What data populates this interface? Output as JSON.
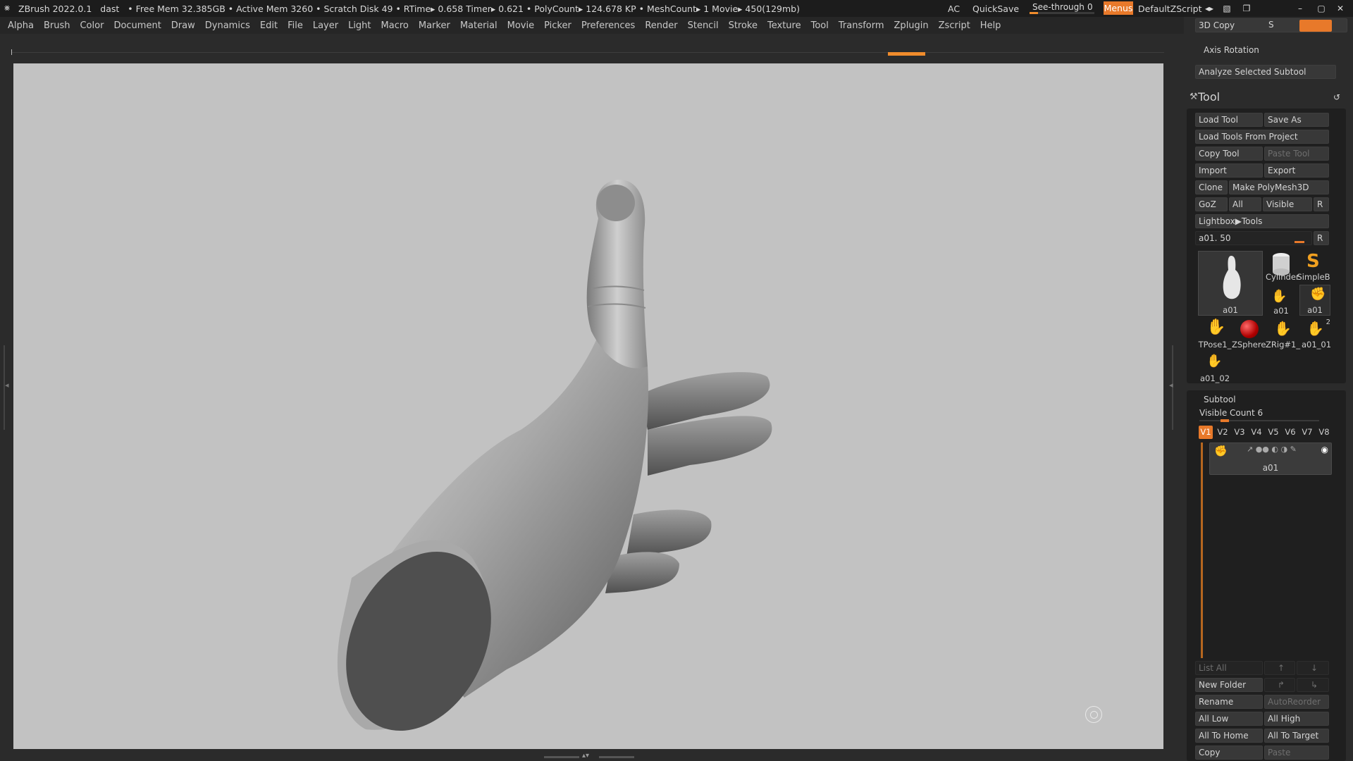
{
  "titlebar": {
    "app": "ZBrush 2022.0.1",
    "project": "dast",
    "stats": "• Free Mem 32.385GB • Active Mem 3260 • Scratch Disk 49 • RTime▸ 0.658 Timer▸ 0.621 • PolyCount▸ 124.678 KP • MeshCount▸ 1  Movie▸ 450(129mb)",
    "ac": "AC",
    "quicksave": "QuickSave",
    "seethrough_label": "See-through",
    "seethrough_value": "0",
    "menus": "Menus",
    "script": "DefaultZScript"
  },
  "menubar": [
    "Alpha",
    "Brush",
    "Color",
    "Document",
    "Draw",
    "Dynamics",
    "Edit",
    "File",
    "Layer",
    "Light",
    "Macro",
    "Marker",
    "Material",
    "Movie",
    "Picker",
    "Preferences",
    "Render",
    "Stencil",
    "Stroke",
    "Texture",
    "Tool",
    "Transform",
    "Zplugin",
    "Zscript",
    "Help"
  ],
  "top_panel": {
    "copy3d": "3D Copy",
    "s": "S",
    "axis_rotation": "Axis Rotation",
    "analyze": "Analyze Selected Subtool"
  },
  "tool": {
    "title": "Tool",
    "load_tool": "Load Tool",
    "save_as": "Save As",
    "load_from_project": "Load Tools From Project",
    "copy_tool": "Copy Tool",
    "paste_tool": "Paste Tool",
    "import": "Import",
    "export": "Export",
    "clone": "Clone",
    "make_polymesh": "Make PolyMesh3D",
    "goz": "GoZ",
    "all": "All",
    "visible": "Visible",
    "r": "R",
    "lightbox": "Lightbox▶Tools",
    "current_label": "a01. 50",
    "thumbs": [
      {
        "name": "a01"
      },
      {
        "name": "Cylinder"
      },
      {
        "name": "SimpleB"
      },
      {
        "name": "a01"
      },
      {
        "name": "a01"
      },
      {
        "name": "TPose1_"
      },
      {
        "name": "ZSphere"
      },
      {
        "name": "ZRig#1_"
      },
      {
        "name": "a01_01"
      },
      {
        "name": "a01_02"
      }
    ],
    "badge": "2"
  },
  "subtool": {
    "title": "Subtool",
    "visible_count": "Visible Count 6",
    "versions": [
      "V1",
      "V2",
      "V3",
      "V4",
      "V5",
      "V6",
      "V7",
      "V8"
    ],
    "active_item": "a01",
    "list_all": "List All",
    "new_folder": "New Folder",
    "rename": "Rename",
    "autoreorder": "AutoReorder",
    "all_low": "All Low",
    "all_high": "All High",
    "all_to_home": "All To Home",
    "all_to_target": "All To Target",
    "copy": "Copy",
    "paste": "Paste"
  },
  "colors": {
    "accent": "#e8792a",
    "viewport_bg": "#c2c2c2"
  }
}
